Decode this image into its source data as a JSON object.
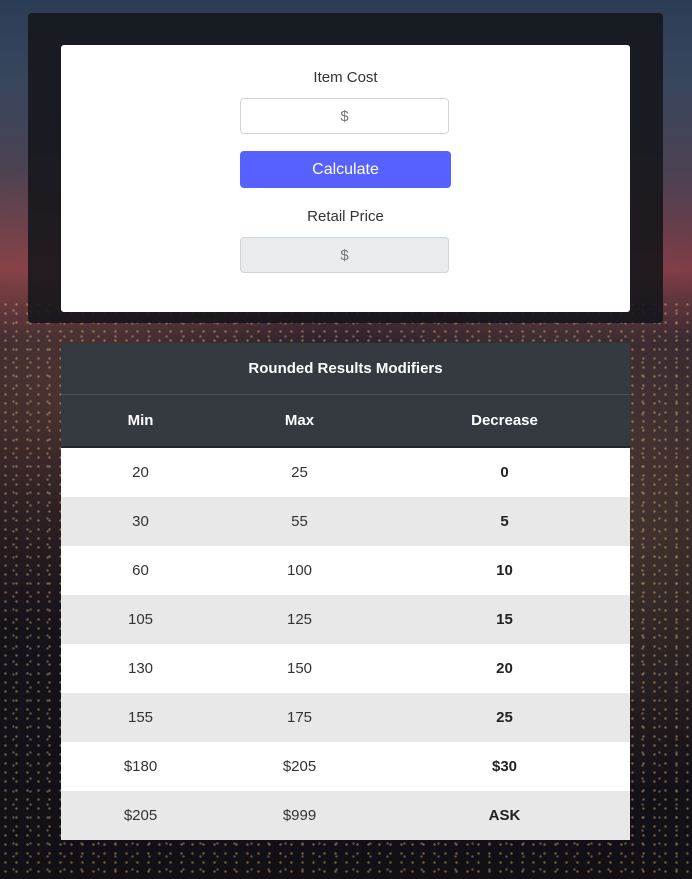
{
  "form": {
    "item_cost_label": "Item Cost",
    "item_cost_placeholder": "$",
    "calculate_label": "Calculate",
    "retail_price_label": "Retail Price",
    "retail_price_placeholder": "$"
  },
  "table": {
    "title": "Rounded Results Modifiers",
    "headers": [
      "Min",
      "Max",
      "Decrease"
    ],
    "rows": [
      [
        "20",
        "25",
        "0"
      ],
      [
        "30",
        "55",
        "5"
      ],
      [
        "60",
        "100",
        "10"
      ],
      [
        "105",
        "125",
        "15"
      ],
      [
        "130",
        "150",
        "20"
      ],
      [
        "155",
        "175",
        "25"
      ],
      [
        "$180",
        "$205",
        "$30"
      ],
      [
        "$205",
        "$999",
        "ASK"
      ]
    ]
  },
  "colors": {
    "accent": "#5661ff",
    "table_header": "#343a40"
  }
}
